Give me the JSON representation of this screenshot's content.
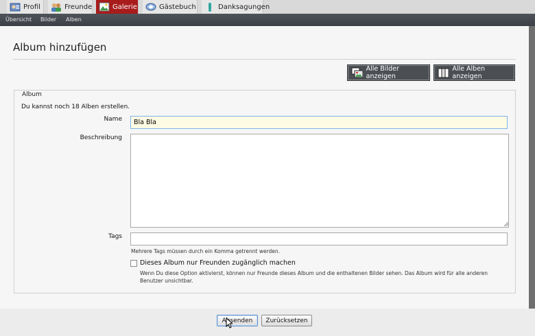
{
  "tabs": [
    {
      "label": "Profil",
      "icon": "profile-icon"
    },
    {
      "label": "Freunde",
      "icon": "friends-icon"
    },
    {
      "label": "Galerie",
      "icon": "gallery-icon",
      "active": true
    },
    {
      "label": "Gästebuch",
      "icon": "guestbook-icon"
    },
    {
      "label": "Danksagungen",
      "icon": "thanks-icon"
    }
  ],
  "subnav": [
    "Übersicht",
    "Bilder",
    "Alben"
  ],
  "page": {
    "title": "Album hinzufügen",
    "buttons": {
      "all_images": "Alle Bilder anzeigen",
      "all_albums": "Alle Alben anzeigen"
    }
  },
  "form": {
    "legend": "Album",
    "info": "Du kannst noch 18 Alben erstellen.",
    "name_label": "Name",
    "name_value": "Bla Bla",
    "description_label": "Beschreibung",
    "description_value": "",
    "tags_label": "Tags",
    "tags_value": "",
    "tags_hint": "Mehrere Tags müssen durch ein Komma getrennt werden.",
    "friends_only_label": "Dieses Album nur Freunden zugänglich machen",
    "friends_only_checked": false,
    "friends_only_desc": "Wenn Du diese Option aktivierst, können nur Freunde dieses Album und die enthaltenen Bilder sehen. Das Album wird für alle anderen Benutzer unsichtbar.",
    "submit": "Absenden",
    "reset": "Zurücksetzen"
  },
  "colors": {
    "active_tab": "#a81c1c",
    "subnav": "#45494f",
    "toolbar_button": "#4b4f54",
    "name_field_bg": "#fdfbe3",
    "focus_border": "#7eb4ea"
  }
}
